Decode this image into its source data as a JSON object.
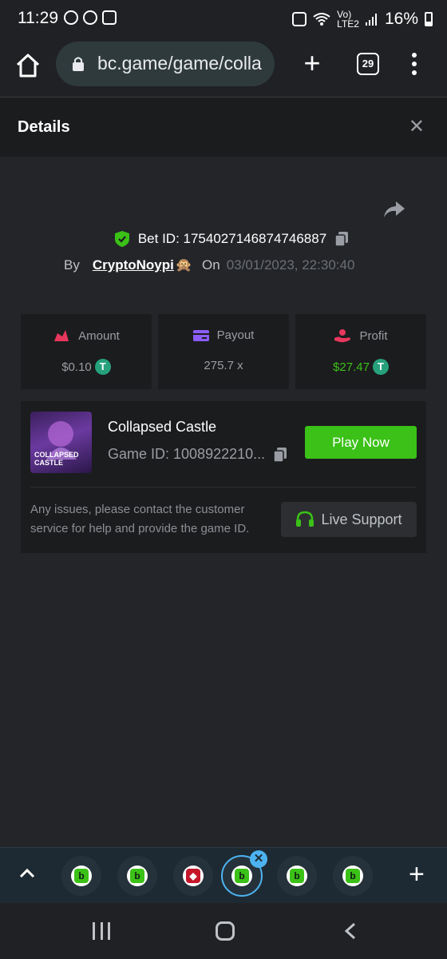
{
  "status_bar": {
    "time": "11:29",
    "net_top": "Vo)",
    "net_bottom": "LTE2",
    "battery": "16%"
  },
  "browser": {
    "url": "bc.game/game/colla",
    "tab_count": "29"
  },
  "details": {
    "title": "Details"
  },
  "bet": {
    "bet_id": "Bet ID: 1754027146874746887",
    "by_label": "By",
    "username": "CryptoNoypi",
    "emoji": "🙊",
    "on_label": "On",
    "date": "03/01/2023, 22:30:40"
  },
  "stats": {
    "amount": {
      "label": "Amount",
      "value": "$0.10"
    },
    "payout": {
      "label": "Payout",
      "value": "275.7 x"
    },
    "profit": {
      "label": "Profit",
      "value": "$27.47"
    },
    "tether_symbol": "T",
    "colors": {
      "amount": "#e8375d",
      "payout": "#8b5cf6",
      "profit": "#e8375d",
      "profit_value": "#3bc117"
    }
  },
  "game": {
    "thumb_title_line1": "COLLAPSED",
    "thumb_title_line2": "CASTLE",
    "name": "Collapsed Castle",
    "game_id": "Game ID: 1008922210...",
    "play_label": "Play Now",
    "support_text": "Any issues, please contact the customer service for help and provide the game ID.",
    "support_label": "Live Support"
  },
  "tabs": {
    "favicon_letter": "b",
    "accent": "#4db3f0",
    "close_symbol": "✕"
  }
}
